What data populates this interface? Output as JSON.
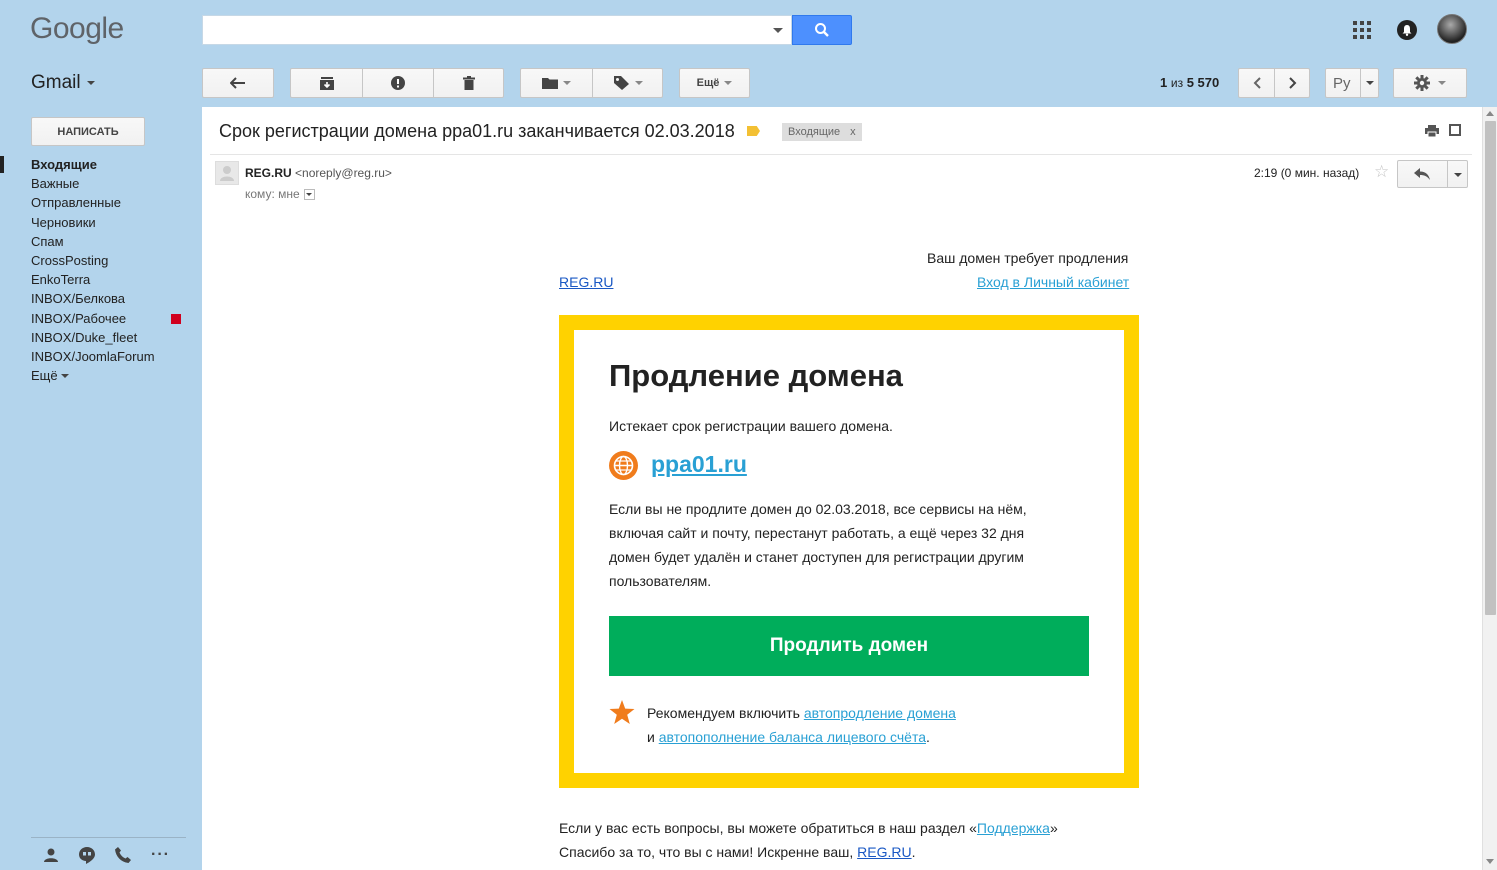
{
  "topbar": {
    "logo": "Google",
    "search_placeholder": "",
    "app_label": "Gmail"
  },
  "toolbar": {
    "more_label": "Ещё",
    "pager_current": "1",
    "pager_sep": "из",
    "pager_total": "5 570",
    "lang_label": "Ру"
  },
  "sidebar": {
    "compose_label": "НАПИСАТЬ",
    "items": [
      {
        "label": "Входящие"
      },
      {
        "label": "Важные"
      },
      {
        "label": "Отправленные"
      },
      {
        "label": "Черновики"
      },
      {
        "label": "Спам"
      },
      {
        "label": "CrossPosting"
      },
      {
        "label": "EnkoTerra"
      },
      {
        "label": "INBOX/Белкова"
      },
      {
        "label": "INBOX/Рабочее"
      },
      {
        "label": "INBOX/Duke_fleet"
      },
      {
        "label": "INBOX/JoomlaForum"
      },
      {
        "label": "Ещё"
      }
    ],
    "flag_color": "#d0001e"
  },
  "message": {
    "subject": "Срок регистрации домена ppa01.ru заканчивается 02.03.2018",
    "label_chip": "Входящие",
    "label_chip_close": "x",
    "sender_name": "REG.RU",
    "sender_email": "<noreply@reg.ru>",
    "to_line": "кому: мне",
    "time": "2:19 (0 мин. назад)"
  },
  "email": {
    "header_text": "Ваш домен требует продления",
    "brand_link": "REG.RU",
    "cabinet_link": "Вход в Личный кабинет",
    "card_title": "Продление домена",
    "card_subtitle": "Истекает срок регистрации вашего домена.",
    "domain": "ppa01.ru",
    "card_text_1": "Если вы не продлите домен до 02.03.2018, все сервисы на нём,",
    "card_text_2": "включая сайт и почту, перестанут работать, а ещё через 32 дня",
    "card_text_3": "домен будет удалён и станет доступен для регистрации другим",
    "card_text_4": "пользователям.",
    "button_label": "Продлить домен",
    "rec_prefix": "Рекомендуем включить",
    "rec_link_1": "автопродление домена",
    "rec_and": "и",
    "rec_link_2": "автопополнение баланса лицевого счёта",
    "rec_end": ".",
    "footer_1_prefix": "Если у вас есть вопросы, вы можете обратиться в наш раздел «",
    "footer_1_link": "Поддержка",
    "footer_1_suffix": "»",
    "footer_2_prefix": "Спасибо за то, что вы с нами! Искренне ваш,",
    "footer_2_link": "REG.RU",
    "footer_2_suffix": "."
  },
  "colors": {
    "page_bg": "#b3d4ec",
    "accent_blue": "#4d90fe",
    "frame_yellow": "#ffd200",
    "button_green": "#00ad5b",
    "link_blue": "#29a0d4",
    "orange": "#f07c1c"
  },
  "icons": [
    "search-icon",
    "apps-icon",
    "bell-icon",
    "reply-icon",
    "archive-icon",
    "spam-icon",
    "trash-icon",
    "folder-icon",
    "tag-icon",
    "chevron-left-icon",
    "chevron-right-icon",
    "gear-icon",
    "print-icon",
    "new-window-icon",
    "star-icon",
    "globe-icon",
    "person-icon",
    "hangouts-icon",
    "phone-icon",
    "more-icon"
  ]
}
